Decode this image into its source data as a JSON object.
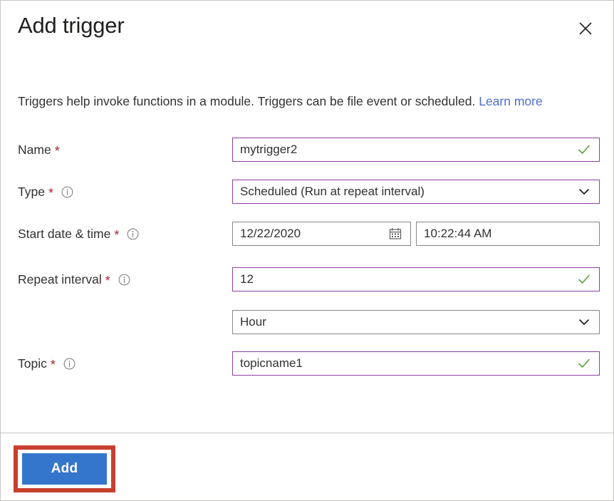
{
  "dialog": {
    "title": "Add trigger",
    "close_icon": "close-icon",
    "description_prefix": "Triggers help invoke functions in a module. Triggers can be file event or scheduled. ",
    "learn_more_label": "Learn more"
  },
  "fields": {
    "name": {
      "label": "Name",
      "required_marker": "*",
      "value": "mytrigger2",
      "validation_icon": "checkmark-icon",
      "border_color": "#8e3fa0"
    },
    "type": {
      "label": "Type",
      "required_marker": "*",
      "info_icon": "info-icon",
      "value": "Scheduled (Run at repeat interval)",
      "caret_icon": "chevron-down-icon",
      "border_color": "#8e3fa0"
    },
    "start": {
      "label": "Start date & time",
      "required_marker": "*",
      "info_icon": "info-icon",
      "date_value": "12/22/2020",
      "date_icon": "calendar-icon",
      "time_value": "10:22:44 AM",
      "border_color": "#8a8886"
    },
    "repeat": {
      "label": "Repeat interval",
      "required_marker": "*",
      "info_icon": "info-icon",
      "value": "12",
      "validation_icon": "checkmark-icon",
      "border_color": "#8e3fa0"
    },
    "unit": {
      "value": "Hour",
      "caret_icon": "chevron-down-icon",
      "border_color": "#8a8886"
    },
    "topic": {
      "label": "Topic",
      "required_marker": "*",
      "info_icon": "info-icon",
      "value": "topicname1",
      "validation_icon": "checkmark-icon",
      "border_color": "#8e3fa0"
    }
  },
  "footer": {
    "add_label": "Add",
    "add_button_color": "#3576cd",
    "highlight_color": "#c9402f"
  },
  "colors": {
    "required_asterisk": "#a4262c",
    "link": "#4c6ecf",
    "checkmark": "#5ca13a",
    "text": "#323130"
  }
}
